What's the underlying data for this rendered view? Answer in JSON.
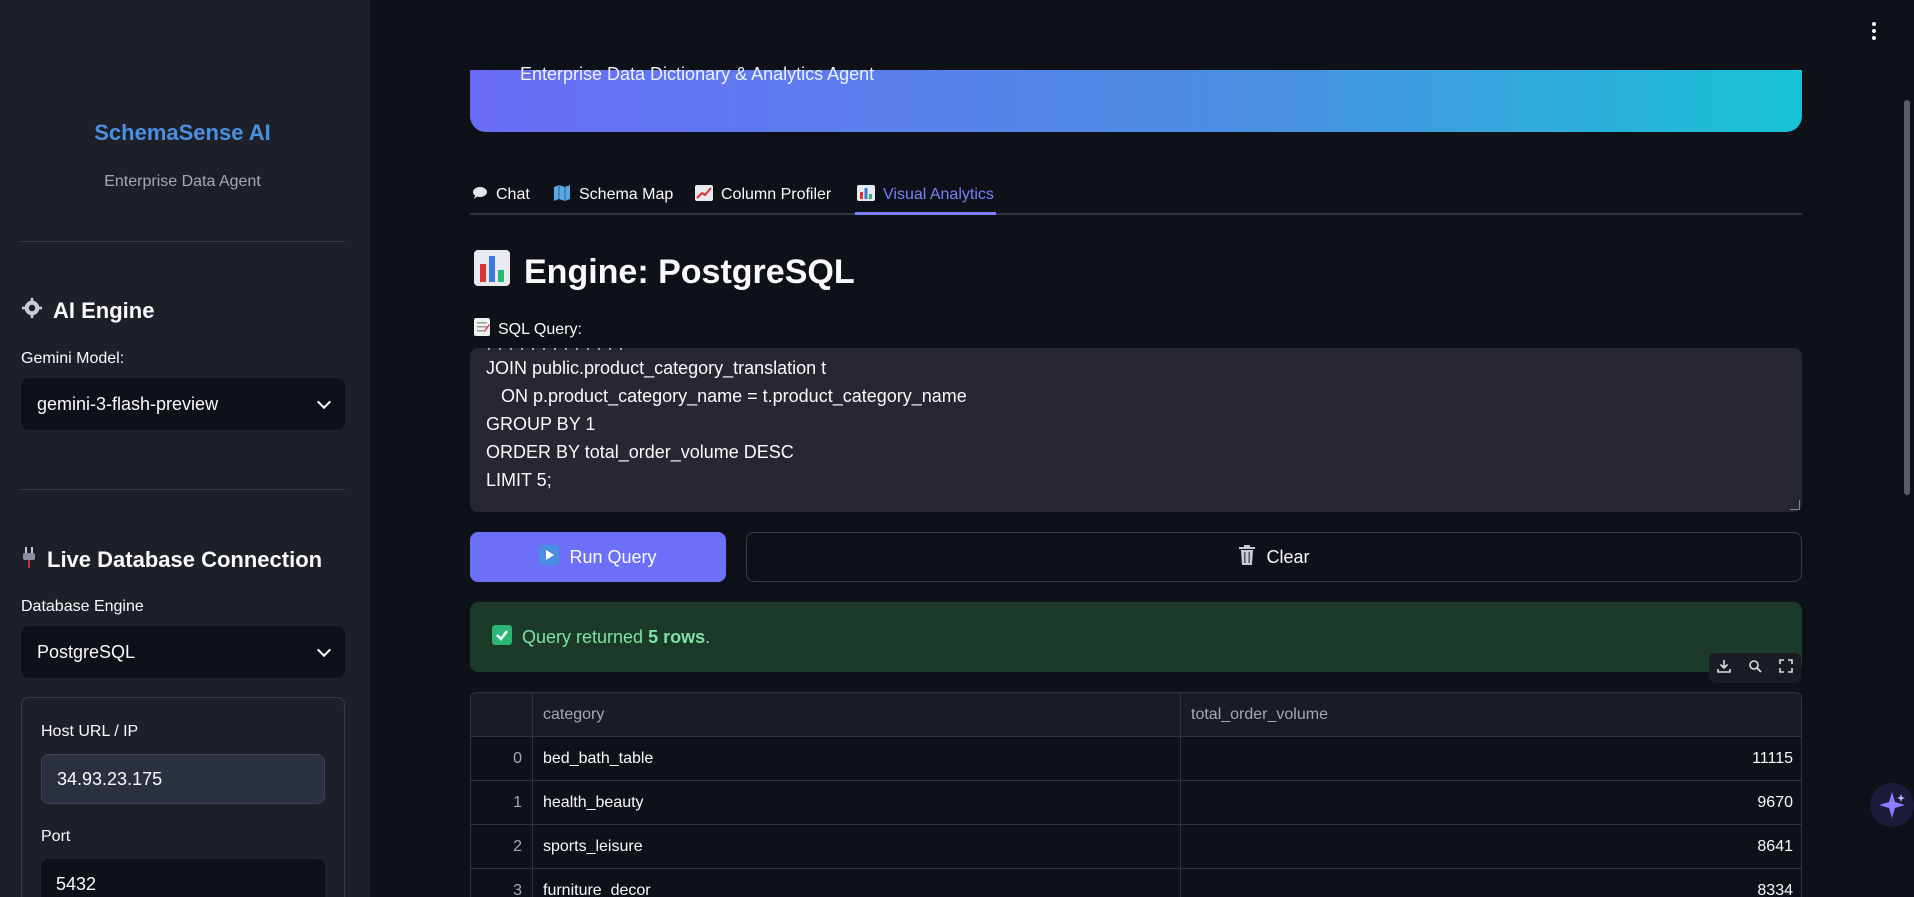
{
  "sidebar": {
    "brand_title": "SchemaSense AI",
    "brand_subtitle": "Enterprise Data Agent",
    "ai_engine": {
      "heading": "AI Engine",
      "model_label": "Gemini Model:",
      "model_value": "gemini-3-flash-preview"
    },
    "connection": {
      "heading": "Live Database Connection",
      "engine_label": "Database Engine",
      "engine_value": "PostgreSQL",
      "host_label": "Host URL / IP",
      "host_value": "34.93.23.175",
      "port_label": "Port",
      "port_value": "5432"
    }
  },
  "hero": {
    "subtitle": "Enterprise Data Dictionary & Analytics Agent"
  },
  "tabs": [
    {
      "label": "Chat",
      "icon": "speech-bubble-icon"
    },
    {
      "label": "Schema Map",
      "icon": "map-icon"
    },
    {
      "label": "Column Profiler",
      "icon": "trend-chart-icon"
    },
    {
      "label": "Visual Analytics",
      "icon": "bar-chart-icon",
      "active": true
    }
  ],
  "main": {
    "title": "Engine: PostgreSQL",
    "sql_label": "SQL Query:",
    "sql_lines": [
      "JOIN public.product_category_translation t",
      "   ON p.product_category_name = t.product_category_name",
      "GROUP BY 1",
      "ORDER BY total_order_volume DESC",
      "LIMIT 5;"
    ],
    "run_label": "Run Query",
    "clear_label": "Clear",
    "success_prefix": "Query returned ",
    "success_bold": "5 rows",
    "success_suffix": "."
  },
  "table": {
    "columns": [
      "category",
      "total_order_volume"
    ],
    "rows": [
      {
        "idx": "0",
        "category": "bed_bath_table",
        "volume": "11115"
      },
      {
        "idx": "1",
        "category": "health_beauty",
        "volume": "9670"
      },
      {
        "idx": "2",
        "category": "sports_leisure",
        "volume": "8641"
      },
      {
        "idx": "3",
        "category": "furniture_decor",
        "volume": "8334"
      }
    ]
  },
  "colors": {
    "accent": "#6c6ff7",
    "brand": "#4a90e2",
    "success_bg": "#1c3a2a",
    "success_text": "#7ee2a4"
  }
}
